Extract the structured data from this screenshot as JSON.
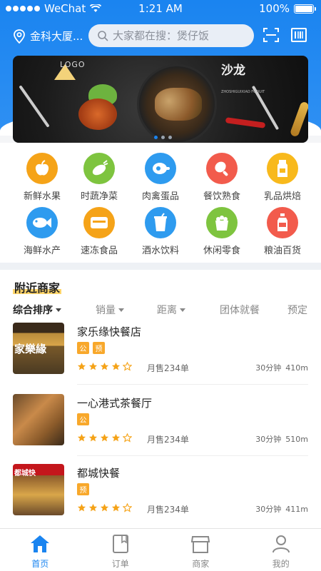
{
  "status_bar": {
    "carrier": "WeChat",
    "time": "1:21 AM",
    "battery": "100%",
    "battery_level": 1.0
  },
  "header": {
    "location": "金科大厦...",
    "search_placeholder": "大家都在搜：煲仔饭"
  },
  "banner": {
    "logo_text": "LOGO",
    "brand_text": "沙龙",
    "brand_sub": "ZHOSHIGUIXIAO FOOUIT",
    "slide_count": 3,
    "active_slide": 0
  },
  "categories": [
    {
      "label": "新鲜水果",
      "icon": "apple-icon",
      "color": "#f5a318"
    },
    {
      "label": "时蔬净菜",
      "icon": "vegetable-icon",
      "color": "#7ec43f"
    },
    {
      "label": "肉禽蛋品",
      "icon": "meat-icon",
      "color": "#2e9bef"
    },
    {
      "label": "餐饮熟食",
      "icon": "drumstick-icon",
      "color": "#f25b4c"
    },
    {
      "label": "乳品烘焙",
      "icon": "milk-icon",
      "color": "#f8b91c"
    },
    {
      "label": "海鲜水产",
      "icon": "fish-icon",
      "color": "#2e9bef"
    },
    {
      "label": "速冻食品",
      "icon": "frozen-box-icon",
      "color": "#f5a318"
    },
    {
      "label": "酒水饮料",
      "icon": "drink-cup-icon",
      "color": "#2e9bef"
    },
    {
      "label": "休闲零食",
      "icon": "snack-icon",
      "color": "#7ec43f"
    },
    {
      "label": "粮油百货",
      "icon": "oil-bottle-icon",
      "color": "#f25b4c"
    }
  ],
  "nearby": {
    "title": "附近商家",
    "filters": [
      {
        "label": "综合排序",
        "has_arrow": true,
        "active": true
      },
      {
        "label": "销量",
        "has_arrow": true,
        "active": false
      },
      {
        "label": "距离",
        "has_arrow": true,
        "active": false
      },
      {
        "label": "团体就餐",
        "has_arrow": false,
        "active": false
      },
      {
        "label": "预定",
        "has_arrow": false,
        "active": false
      }
    ],
    "merchants": [
      {
        "name": "家乐缘快餐店",
        "tags": [
          "公",
          "预"
        ],
        "rating": 4,
        "sales": "月售234单",
        "time": "30分钟",
        "distance": "410m",
        "sign_text": "家樂緣"
      },
      {
        "name": "一心港式茶餐厅",
        "tags": [
          "公"
        ],
        "rating": 4,
        "sales": "月售234单",
        "time": "30分钟",
        "distance": "510m",
        "sign_text": ""
      },
      {
        "name": "都城快餐",
        "tags": [
          "预"
        ],
        "rating": 4,
        "sales": "月售234单",
        "time": "30分钟",
        "distance": "411m",
        "sign_text": "都城快"
      }
    ]
  },
  "tabbar": [
    {
      "label": "首页",
      "icon": "home-icon",
      "active": true
    },
    {
      "label": "订单",
      "icon": "order-icon",
      "active": false
    },
    {
      "label": "商家",
      "icon": "shop-icon",
      "active": false
    },
    {
      "label": "我的",
      "icon": "user-icon",
      "active": false
    }
  ],
  "colors": {
    "brand_blue": "#1a84f0",
    "tag_orange": "#f8a82b",
    "star_orange": "#f5a318"
  }
}
